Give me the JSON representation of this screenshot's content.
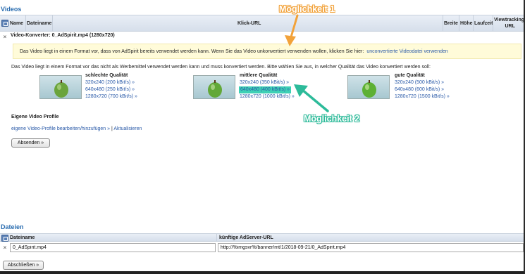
{
  "videos": {
    "section_title": "Videos",
    "columns": {
      "name": "Name",
      "dateiname": "Dateiname",
      "klick_url": "Klick-URL",
      "breite": "Breite",
      "hoehe": "Höhe",
      "laufzeit": "Laufzeit",
      "viewtracking": "Viewtracking-URL"
    },
    "converter_title": "Video-Konverter: 0_AdSpirit.mp4 (1280x720)",
    "notice_text": "Das Video liegt in einem Format vor, dass von AdSpirit bereits verwendet werden kann. Wenn Sie das Video unkonvertiert verwenden wollen, klicken Sie hier:",
    "notice_link": "unconvertierte Videodatei verwenden",
    "convert_text": "Das Video liegt in einem Format vor das nicht als Werbemittel verwendet werden kann und muss konvertiert werden. Bitte wählen Sie aus, in welcher Qualität das Video konvertiert werden soll:",
    "qualities": [
      {
        "title": "schlechte Qualität",
        "options": [
          "320x240 (200 kBit/s) »",
          "640x480 (250 kBit/s) »",
          "1280x720 (700 kBit/s) »"
        ]
      },
      {
        "title": "mittlere Qualität",
        "options": [
          "320x240 (350 kBit/s) »",
          "640x480 (400 kBit/s) »",
          "1280x720 (1000 kBit/s) »"
        ]
      },
      {
        "title": "gute Qualität",
        "options": [
          "320x240 (500 kBit/s) »",
          "640x480 (600 kBit/s) »",
          "1280x720 (1500 kBit/s) »"
        ]
      }
    ],
    "profiles_title": "Eigene Video Profile",
    "profiles_edit": "eigene Video-Profile bearbeiten/hinzufügen »",
    "profiles_sep": "|",
    "profiles_refresh": "Aktualisieren",
    "submit_label": "Absenden »"
  },
  "annotations": {
    "option1": "Möglichkeit 1",
    "option2": "Möglichkeit 2",
    "option1_color": "#f2a23a",
    "option2_color": "#2dbb9a",
    "highlight_color": "#3ed0b5"
  },
  "dateien": {
    "section_title": "Dateien",
    "columns": {
      "dateiname": "Dateiname",
      "adserver_url": "künftige AdServer-URL"
    },
    "row": {
      "filename": "0_AdSpirit.mp4",
      "url": "http://%imgsvr%/banner/mt/1/2018-09-21/0_AdSpirit.mp4"
    },
    "close_label": "Abschließen »"
  }
}
